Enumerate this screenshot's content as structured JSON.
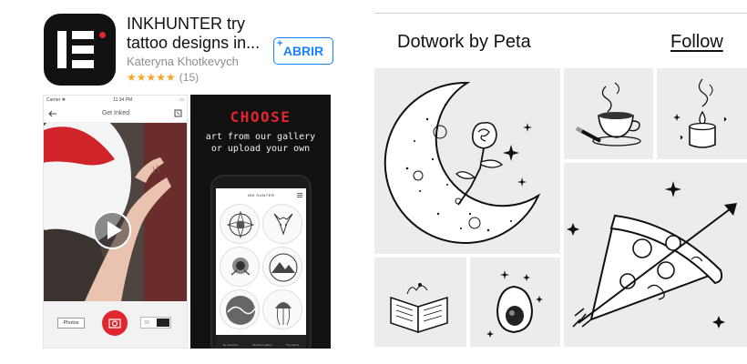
{
  "app": {
    "title": "INKHUNTER try tattoo designs in...",
    "developer": "Kateryna Khotkevych",
    "rating_stars": "★★★★★",
    "rating_count": "(15)",
    "open_button": "ABRIR",
    "plus": "+",
    "colors": {
      "accent": "#1a82fb",
      "brand_red": "#e2262f",
      "star": "#f5a623"
    }
  },
  "screenshot1": {
    "status_carrier": "Carrier ❖",
    "status_time": "11:34 PM",
    "status_battery": "▭",
    "nav_title": "Get Inked",
    "photos_label": "Photos",
    "toggle_label": "3D"
  },
  "screenshot2": {
    "title": "CHOOSE",
    "subtitle_line1": "art from our gallery",
    "subtitle_line2": "or upload your own",
    "header": "INK HUNTER",
    "tabs": [
      "My sketches",
      "Sketches gallery",
      "My photos"
    ]
  },
  "collection": {
    "title": "Dotwork by Peta",
    "follow_label": "Follow",
    "tiles": [
      "moon-rose",
      "coffee-cup",
      "candle",
      "pizza-arrow",
      "open-book",
      "avocado"
    ]
  }
}
